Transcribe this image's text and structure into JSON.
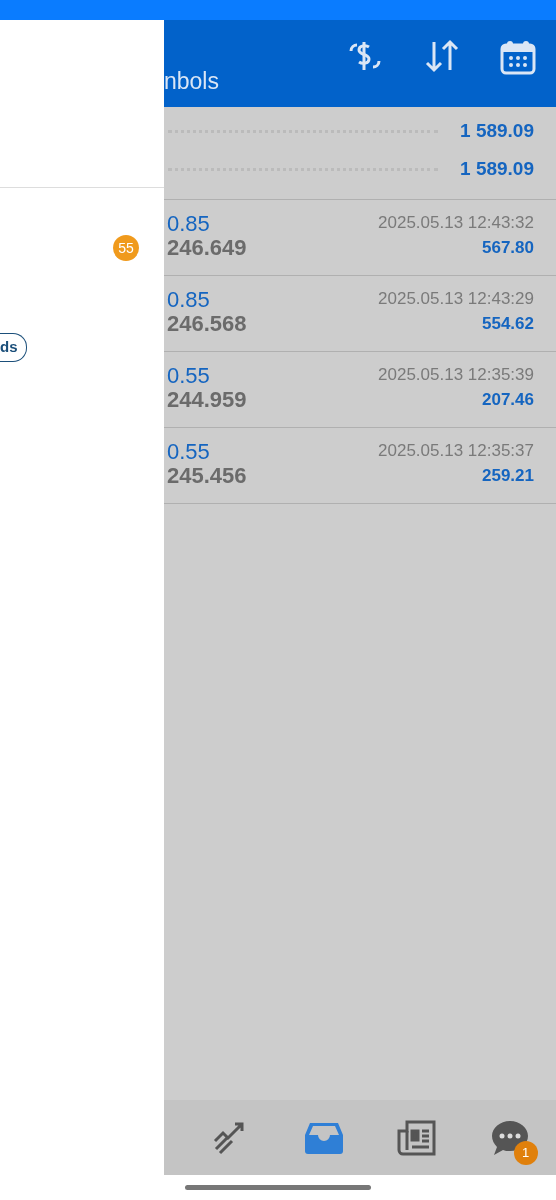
{
  "drawer": {
    "badge": "55",
    "pill": "ds"
  },
  "header": {
    "title": "nbols"
  },
  "summary": [
    {
      "value": "1 589.09"
    },
    {
      "value": "1 589.09"
    }
  ],
  "trades": [
    {
      "volume": "0.85",
      "price": "246.649",
      "time": "2025.05.13 12:43:32",
      "profit": "567.80"
    },
    {
      "volume": "0.85",
      "price": "246.568",
      "time": "2025.05.13 12:43:29",
      "profit": "554.62"
    },
    {
      "volume": "0.55",
      "price": "244.959",
      "time": "2025.05.13 12:35:39",
      "profit": "207.46"
    },
    {
      "volume": "0.55",
      "price": "245.456",
      "time": "2025.05.13 12:35:37",
      "profit": "259.21"
    }
  ],
  "bottom_nav": [
    {
      "kind": "chart",
      "selected": false
    },
    {
      "kind": "inbox",
      "selected": true
    },
    {
      "kind": "news",
      "selected": false
    },
    {
      "kind": "chat",
      "selected": false,
      "badge": "1"
    }
  ]
}
